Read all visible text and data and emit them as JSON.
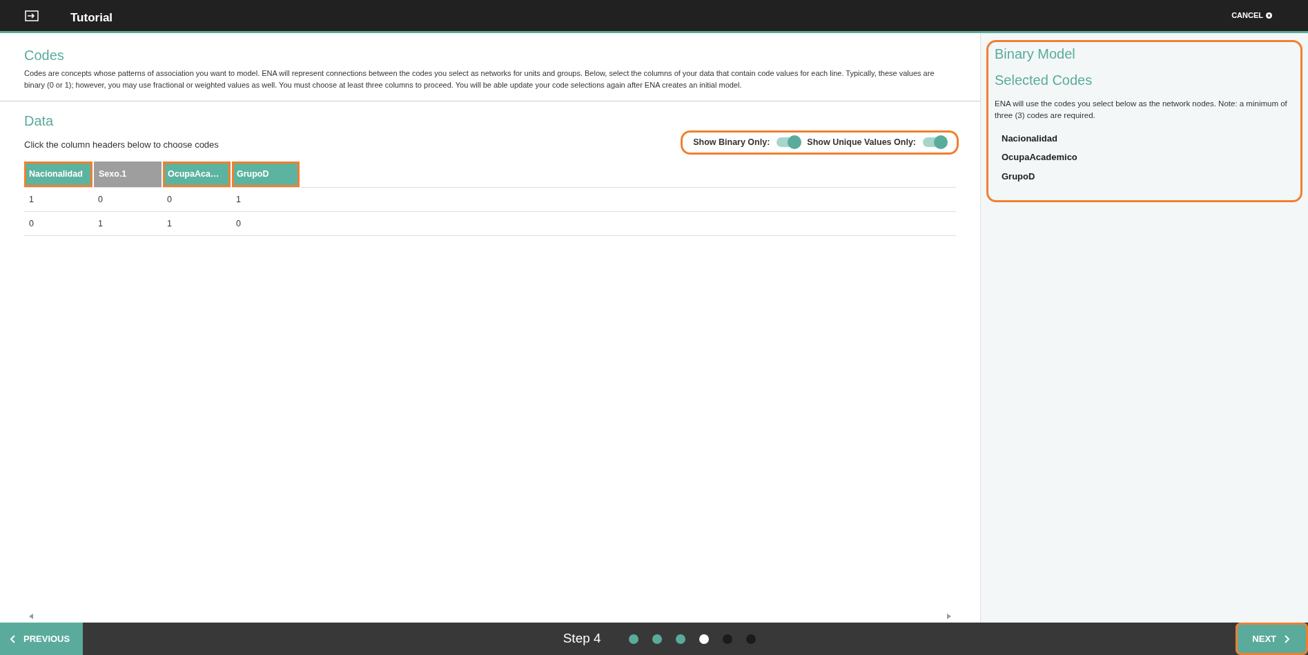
{
  "header": {
    "title": "Tutorial",
    "cancel": "CANCEL"
  },
  "codes": {
    "heading": "Codes",
    "description": "Codes are concepts whose patterns of association you want to model. ENA will represent connections between the codes you select as networks for units and groups. Below, select the columns of your data that contain code values for each line. Typically, these values are binary (0 or 1); however, you may use fractional or weighted values as well. You must choose at least three columns to proceed. You will be able update your code selections again after ENA creates an initial model."
  },
  "data": {
    "heading": "Data",
    "hint": "Click the column headers below to choose codes",
    "toggles": {
      "highlighted": true,
      "items": [
        {
          "label": "Show Binary Only:",
          "on": true
        },
        {
          "label": "Show Unique Values Only:",
          "on": true
        }
      ]
    },
    "table": {
      "columns": [
        {
          "label": "Nacionalidad",
          "selected": true,
          "highlighted": true
        },
        {
          "label": "Sexo.1",
          "selected": false,
          "highlighted": false
        },
        {
          "label": "OcupaAca…",
          "selected": true,
          "highlighted": true
        },
        {
          "label": "GrupoD",
          "selected": true,
          "highlighted": true
        }
      ],
      "rows": [
        [
          "1",
          "0",
          "0",
          "1"
        ],
        [
          "0",
          "1",
          "1",
          "0"
        ]
      ]
    }
  },
  "side_panel": {
    "highlighted": true,
    "title": "Binary Model",
    "subtitle": "Selected Codes",
    "note": "ENA will use the codes you select below as the network nodes. Note: a minimum of three (3) codes are required.",
    "codes": [
      "Nacionalidad",
      "OcupaAcademico",
      "GrupoD"
    ]
  },
  "footer": {
    "previous": "PREVIOUS",
    "step": "Step 4",
    "steps": [
      {
        "completed": true,
        "current": false
      },
      {
        "completed": true,
        "current": false
      },
      {
        "completed": true,
        "current": false
      },
      {
        "completed": false,
        "current": true
      },
      {
        "completed": false,
        "current": false
      },
      {
        "completed": false,
        "current": false
      }
    ],
    "next": {
      "label": "NEXT",
      "highlighted": true
    }
  }
}
